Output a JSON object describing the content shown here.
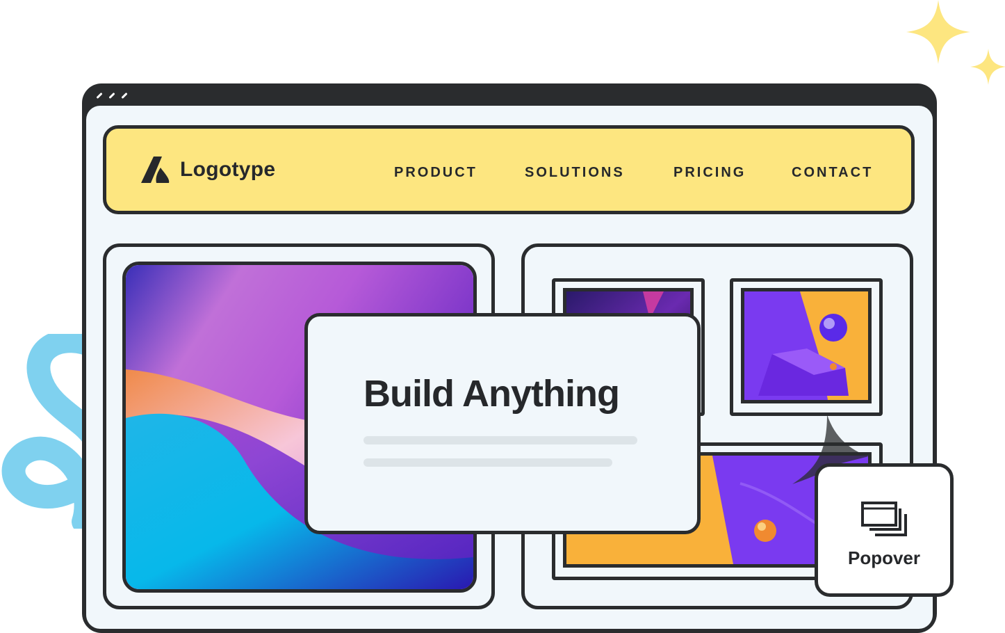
{
  "brand": {
    "name": "Logotype",
    "icon": "logo-mark-icon"
  },
  "nav": {
    "items": [
      {
        "label": "PRODUCT"
      },
      {
        "label": "SOLUTIONS"
      },
      {
        "label": "PRICING"
      },
      {
        "label": "CONTACT"
      }
    ]
  },
  "hero": {
    "title": "Build Anything"
  },
  "popover": {
    "label": "Popover",
    "icon": "stacked-windows-icon"
  },
  "colors": {
    "nav_background": "#fde680",
    "outline": "#2a2c2e",
    "surface": "#f1f7fb",
    "sparkle": "#fde680",
    "squiggle": "#7fd1ef"
  }
}
